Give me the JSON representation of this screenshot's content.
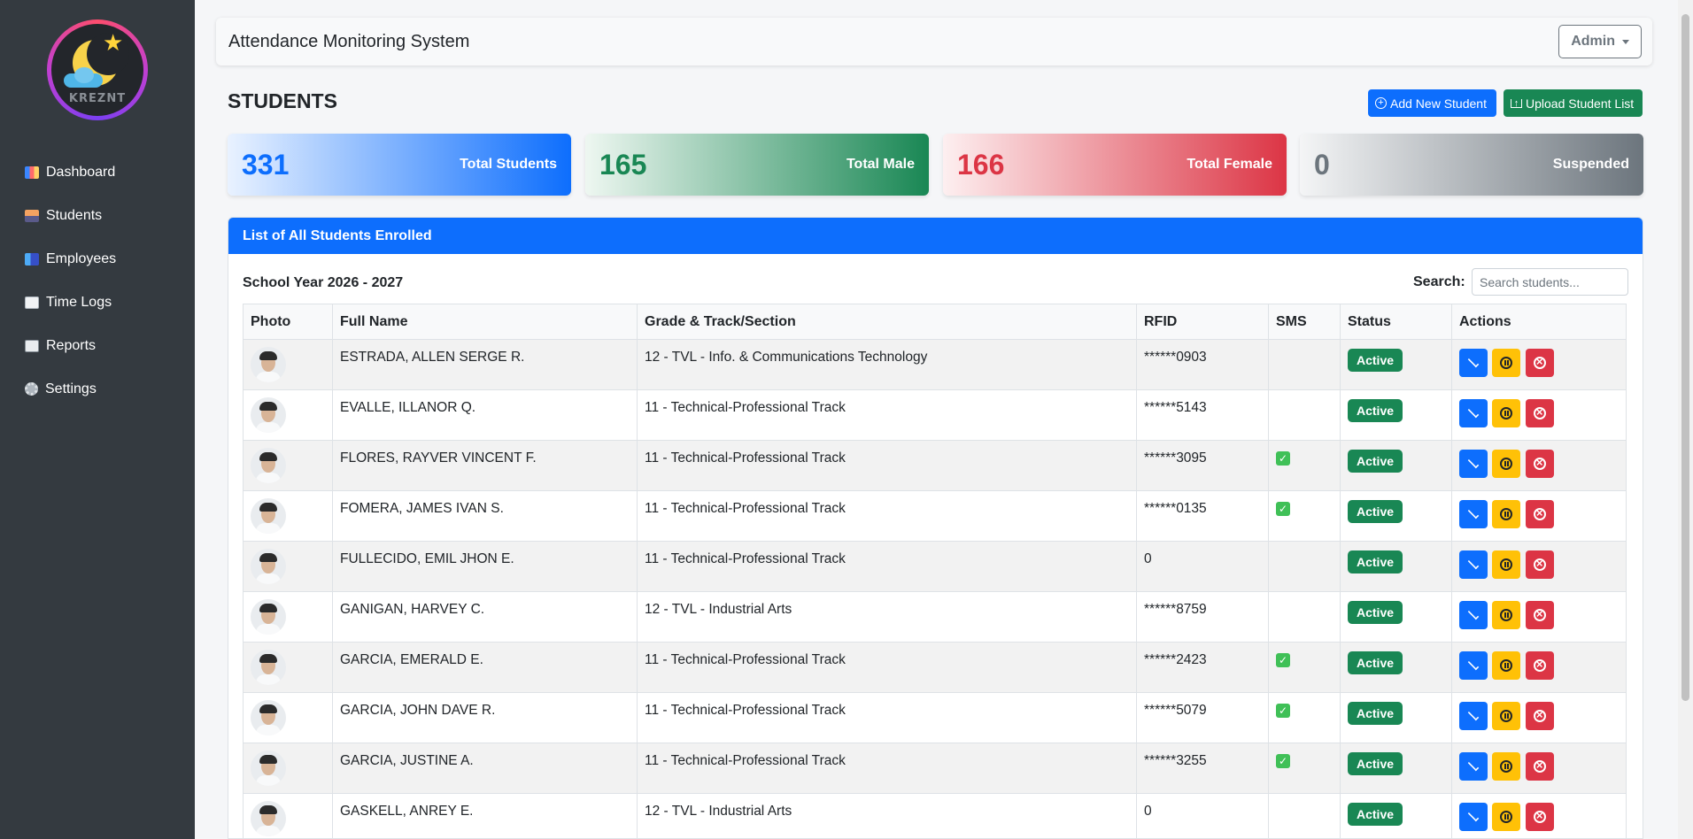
{
  "sidebar": {
    "logo_text": "KREZNT",
    "items": [
      {
        "label": "Dashboard",
        "icon": "dashboard-icon"
      },
      {
        "label": "Students",
        "icon": "students-icon"
      },
      {
        "label": "Employees",
        "icon": "employees-icon"
      },
      {
        "label": "Time Logs",
        "icon": "time-logs-icon"
      },
      {
        "label": "Reports",
        "icon": "reports-icon"
      },
      {
        "label": "Settings",
        "icon": "gear-icon"
      }
    ]
  },
  "header": {
    "title": "Attendance Monitoring System",
    "user_menu": "Admin"
  },
  "page": {
    "title": "STUDENTS",
    "add_button": "Add New Student",
    "upload_button": "Upload Student List"
  },
  "stats": [
    {
      "value": "331",
      "label": "Total Students",
      "color": "#0d6efd"
    },
    {
      "value": "165",
      "label": "Total Male",
      "color": "#198754"
    },
    {
      "value": "166",
      "label": "Total Female",
      "color": "#dc3545"
    },
    {
      "value": "0",
      "label": "Suspended",
      "color": "#6c757d"
    }
  ],
  "table_panel": {
    "title": "List of All Students Enrolled",
    "school_year": "School Year 2026 - 2027",
    "search_label": "Search:",
    "search_placeholder": "Search students...",
    "columns": [
      "Photo",
      "Full Name",
      "Grade & Track/Section",
      "RFID",
      "SMS",
      "Status",
      "Actions"
    ],
    "rows": [
      {
        "name": "ESTRADA, ALLEN SERGE R.",
        "grade": "12 - TVL - Info. & Communications Technology",
        "rfid": "******0903",
        "sms": false,
        "status": "Active"
      },
      {
        "name": "EVALLE, ILLANOR Q.",
        "grade": "11 - Technical-Professional Track",
        "rfid": "******5143",
        "sms": false,
        "status": "Active"
      },
      {
        "name": "FLORES, RAYVER VINCENT F.",
        "grade": "11 - Technical-Professional Track",
        "rfid": "******3095",
        "sms": true,
        "status": "Active"
      },
      {
        "name": "FOMERA, JAMES IVAN S.",
        "grade": "11 - Technical-Professional Track",
        "rfid": "******0135",
        "sms": true,
        "status": "Active"
      },
      {
        "name": "FULLECIDO, EMIL JHON E.",
        "grade": "11 - Technical-Professional Track",
        "rfid": "0",
        "sms": false,
        "status": "Active"
      },
      {
        "name": "GANIGAN, HARVEY C.",
        "grade": "12 - TVL - Industrial Arts",
        "rfid": "******8759",
        "sms": false,
        "status": "Active"
      },
      {
        "name": "GARCIA, EMERALD E.",
        "grade": "11 - Technical-Professional Track",
        "rfid": "******2423",
        "sms": true,
        "status": "Active"
      },
      {
        "name": "GARCIA, JOHN DAVE R.",
        "grade": "11 - Technical-Professional Track",
        "rfid": "******5079",
        "sms": true,
        "status": "Active"
      },
      {
        "name": "GARCIA, JUSTINE A.",
        "grade": "11 - Technical-Professional Track",
        "rfid": "******3255",
        "sms": true,
        "status": "Active"
      },
      {
        "name": "GASKELL, ANREY E.",
        "grade": "12 - TVL - Industrial Arts",
        "rfid": "0",
        "sms": false,
        "status": "Active"
      }
    ]
  }
}
